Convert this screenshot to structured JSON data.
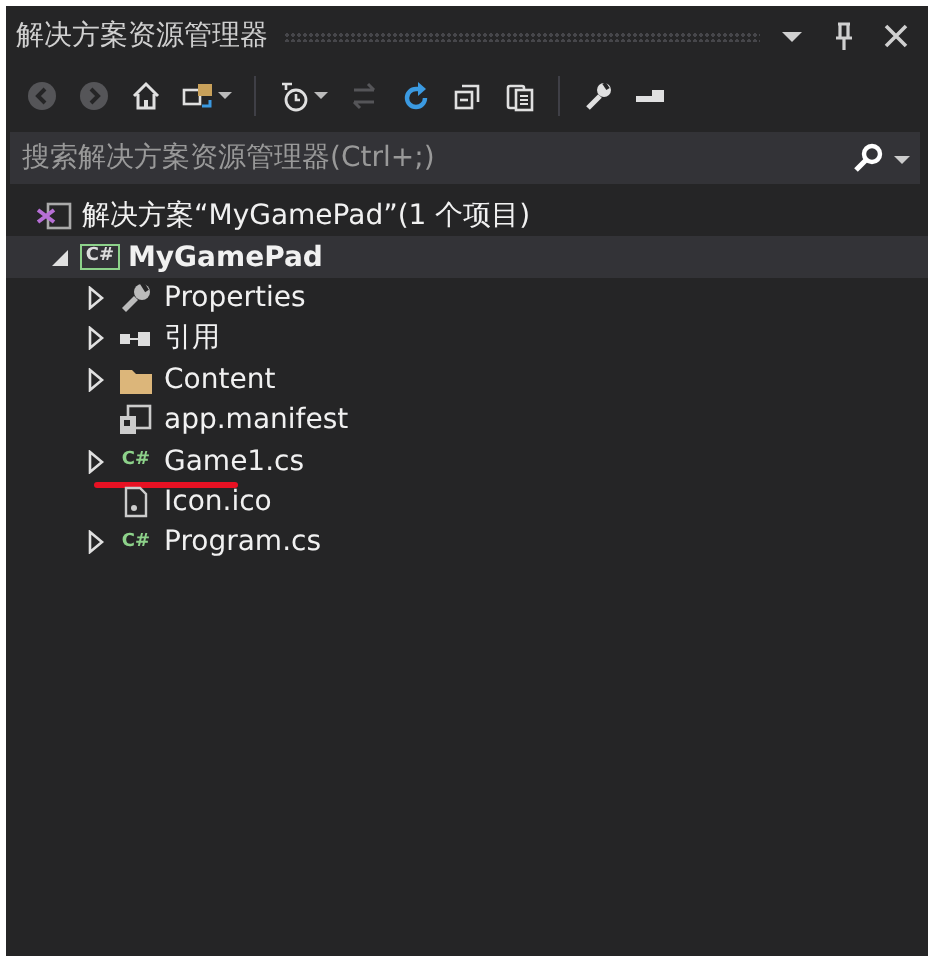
{
  "window": {
    "title": "解决方案资源管理器"
  },
  "title_buttons": [
    {
      "kind": "dropdown"
    },
    {
      "kind": "pin"
    },
    {
      "kind": "close"
    }
  ],
  "toolbar": [
    {
      "kind": "back",
      "disabled": true
    },
    {
      "kind": "forward",
      "disabled": true
    },
    {
      "kind": "home",
      "disabled": false
    },
    {
      "kind": "sync",
      "disabled": false,
      "dropdown": true
    },
    {
      "kind": "separator"
    },
    {
      "kind": "pending",
      "disabled": false,
      "dropdown": true
    },
    {
      "kind": "swap",
      "disabled": true
    },
    {
      "kind": "refresh",
      "disabled": false
    },
    {
      "kind": "collapse",
      "disabled": false
    },
    {
      "kind": "copy",
      "disabled": false
    },
    {
      "kind": "separator"
    },
    {
      "kind": "wrench",
      "disabled": false
    },
    {
      "kind": "preview",
      "disabled": false
    }
  ],
  "search": {
    "placeholder": "搜索解决方案资源管理器(Ctrl+;)"
  },
  "tree": [
    {
      "label": "解决方案“MyGamePad”(1 个项目)",
      "kind": "solution",
      "selected": false,
      "children": [
        {
          "label": "MyGamePad",
          "kind": "project",
          "badge": "C#",
          "expanded": true,
          "selected": true,
          "children": [
            {
              "label": "Properties",
              "kind": "wrench",
              "expanded": false,
              "selected": false
            },
            {
              "label": "引用",
              "kind": "references",
              "expanded": false,
              "selected": false
            },
            {
              "label": "Content",
              "kind": "folder",
              "expanded": false,
              "selected": false
            },
            {
              "label": "app.manifest",
              "kind": "manifest",
              "selected": false
            },
            {
              "label": "Game1.cs",
              "kind": "csharp",
              "badge": "C#",
              "expanded": false,
              "selected": false,
              "underlined": true
            },
            {
              "label": "Icon.ico",
              "kind": "image",
              "selected": false
            },
            {
              "label": "Program.cs",
              "kind": "csharp",
              "badge": "C#",
              "expanded": false,
              "selected": false
            }
          ]
        }
      ]
    }
  ]
}
